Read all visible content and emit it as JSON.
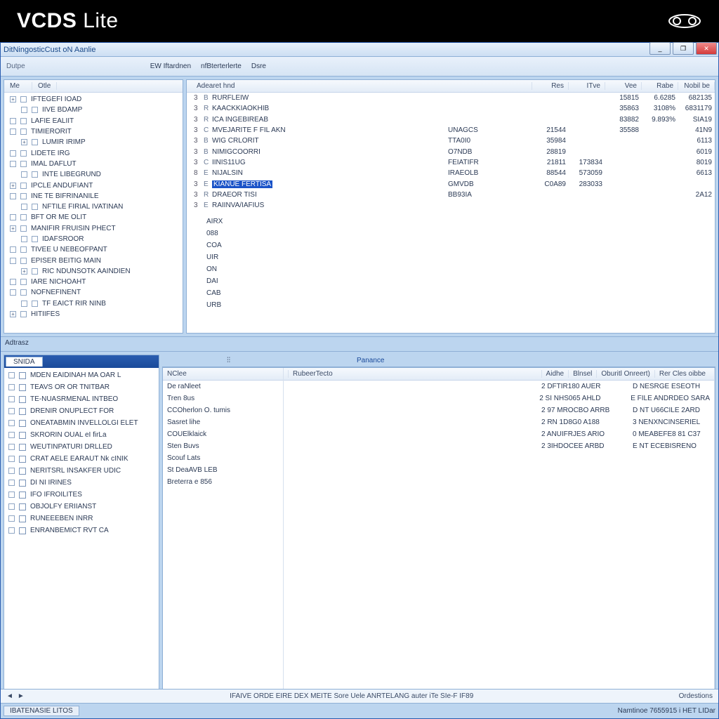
{
  "banner": {
    "title_a": "VCDS",
    "title_b": "Lite"
  },
  "titlebar": {
    "caption": "DitNingosticCust oN Aanlie"
  },
  "winbtns": {
    "min": "_",
    "max": "❐",
    "close": "✕"
  },
  "toolbar": {
    "left": "Dutpe",
    "items": [
      "EW Iftardnen",
      "nfBterterlerte",
      "Dsre"
    ]
  },
  "tree": {
    "headers": [
      "Me",
      "Otle"
    ],
    "items": [
      "IFTEGEFI IOAD",
      "IIVE BDAMP",
      "LAFIE EALIIT",
      "TIMIERORIT",
      "LUMIR IRIMP",
      "LIDETE IRG",
      "IMAL DAFLUT",
      "INTE LIBEGRUND",
      "IPCLE ANDUFIANT",
      "INE TE BIFRINANILE",
      "NFTILE FIRIAL IVATINAN",
      "BFT OR ME OLIT",
      "MANIFIR FRUISIN PHECT",
      "IDAFSROOR",
      "TIVEE U NEBEOFPANT",
      "EPISER BEITIG MAIN",
      "RIC NDUNSOTK AAINDIEN",
      "IARE NICHOAHT",
      "NOFNEFINENT",
      "TF EAICT RIR NINB",
      "HITIIFES"
    ]
  },
  "grid": {
    "headers": {
      "name": "Adearet hnd",
      "c1": "Res",
      "c2": "ITve",
      "c3": "Vee",
      "c4": "Rabe",
      "c5": "Nobil be"
    },
    "rows": [
      {
        "i": "3",
        "k": "B",
        "n": "RURFLEIW",
        "c2": "",
        "r": "",
        "a": "",
        "b": "15815",
        "c": "6.6285",
        "d": "682135"
      },
      {
        "i": "3",
        "k": "R",
        "n": "KAACKKIAOKHIB",
        "c2": "",
        "r": "",
        "a": "",
        "b": "35863",
        "c": "3108%",
        "d": "6831179"
      },
      {
        "i": "3",
        "k": "R",
        "n": "ICA INGEBIREAB",
        "c2": "",
        "r": "",
        "a": "",
        "b": "83882",
        "c": "9.893%",
        "d": "SIA19"
      },
      {
        "i": "3",
        "k": "C",
        "n": "MVEJARITE F FIL AKN",
        "c2": "UNAGCS",
        "r": "21544",
        "a": "",
        "b": "35588",
        "c": "",
        "d": "41N9"
      },
      {
        "i": "3",
        "k": "B",
        "n": "WIG CRLORIT",
        "c2": "TTA0I0",
        "r": "35984",
        "a": "",
        "b": "",
        "c": "",
        "d": "6113"
      },
      {
        "i": "3",
        "k": "B",
        "n": "NIMIGCOORRI",
        "c2": "O7NDB",
        "r": "28819",
        "a": "",
        "b": "",
        "c": "",
        "d": "6019"
      },
      {
        "i": "3",
        "k": "C",
        "n": "IINIS11UG",
        "c2": "FEIATIFR",
        "r": "21811",
        "a": "173834",
        "b": "",
        "c": "",
        "d": "8019"
      },
      {
        "i": "8",
        "k": "E",
        "n": "NIJALSIN",
        "c2": "IRAEOLB",
        "r": "88544",
        "a": "573059",
        "b": "",
        "c": "",
        "d": "6613"
      },
      {
        "i": "3",
        "k": "E",
        "n": "KIANUE FERTISA",
        "c2": "GMVDB",
        "r": "C0A89",
        "a": "283033",
        "b": "",
        "c": "",
        "d": "",
        "sel": true
      },
      {
        "i": "3",
        "k": "R",
        "n": "DRAEOR TISI",
        "c2": "BB93IA",
        "r": "",
        "a": "",
        "b": "",
        "c": "",
        "d": "2A12"
      },
      {
        "i": "3",
        "k": "E",
        "n": "RAIINVA/IAFIUS",
        "c2": "",
        "r": "",
        "a": "",
        "b": "",
        "c": "",
        "d": ""
      }
    ],
    "codes": [
      "AIRX",
      "088",
      "COA",
      "UIR",
      "ON",
      "DAI",
      "CAB",
      "URB"
    ]
  },
  "midsplit": {
    "label": "Adtrasz"
  },
  "lower_left": {
    "tab": "SNIDA",
    "items": [
      "MDEN EAIDINAH MA OAR L",
      "TEAVS OR OR TNITBAR",
      "TE-NUASRMENAL INTBEO",
      "DRENIR ONUPLECT FOR",
      "ONEATABMIN INVELLOLGI ELET",
      "SKRORIN OUAL eI firLa",
      "WEUTINPATURI DRLLED",
      "CRAT AELE EARAUT Nk cINIK",
      "NERITSRL INSAKFER UDIC",
      "DI NI IRINES",
      "IFO IFROILITES",
      "OBJOLFY ERIIANST",
      "RUNEEEBEN INRR",
      "ENRANBEMICT RVT CA"
    ]
  },
  "lower_right": {
    "topbar": {
      "handle": "⫶⫶",
      "lbl": "Panance"
    },
    "col1": {
      "header": "NClee",
      "items": [
        "De raNleet",
        "Tren 8us",
        "CCOherlon O. tumis",
        "Sasret lihe",
        "COUElklaick",
        "Sten Buvs",
        "Scouf Lats",
        "St DeaAVB LEB",
        "Breterra e 856"
      ]
    },
    "col2": {
      "headers": [
        "RubeerTecto",
        "Aidhe",
        "Blnsel",
        "Oburitl Onreert)",
        "Rer Cles oibbe"
      ],
      "rows": [
        {
          "a": "2 DFTIR180 AUER",
          "b": "D  NESRGE ESEOTH"
        },
        {
          "a": "2 SI NHS065 AHLD",
          "b": "E  FILE ANDRDEO SARA"
        },
        {
          "a": "2 97 MROCBO ARRB",
          "b": "D  NT U66CILE 2ARD"
        },
        {
          "a": "2 RN 1D8G0 A188",
          "b": "3  NENXNCINSERIEL"
        },
        {
          "a": "2 ANUIFRJES ARIO",
          "b": "0  MEABEFE8 81 C37"
        },
        {
          "a": "2 3IHDOCEE ARBD",
          "b": "E  NT ECEBISRENO"
        }
      ]
    }
  },
  "footer": {
    "scroll_l": "◄",
    "scroll_r": "►",
    "msg": "IFAIVE ORDE EIRE DEX MEITE  Sore Uele ANRTELANG auter iTe SIe-F IF89",
    "right": "Ordestions"
  },
  "statusbar": {
    "left": "IBATENASIE LITOS",
    "right": "Namtinoe  7655915 i HET LIDar"
  }
}
